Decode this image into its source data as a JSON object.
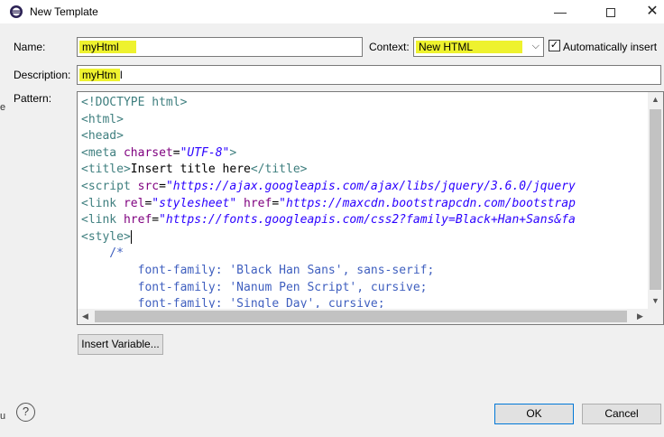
{
  "window": {
    "title": "New Template"
  },
  "form": {
    "name_label": "Name:",
    "name_value": "myHtml",
    "context_label": "Context:",
    "context_value": "New HTML",
    "auto_insert_label": "Automatically insert",
    "auto_insert_checked": true,
    "description_label": "Description:",
    "description_value_highlighted": "myHtm",
    "description_value_rest": "l",
    "pattern_label": "Pattern:",
    "highlight_color": "#eef22e"
  },
  "pattern": {
    "lines": [
      {
        "parts": [
          {
            "t": "tag",
            "s": "<!DOCTYPE html>"
          }
        ]
      },
      {
        "parts": [
          {
            "t": "tag",
            "s": "<html>"
          }
        ]
      },
      {
        "parts": [
          {
            "t": "tag",
            "s": "<head>"
          }
        ]
      },
      {
        "parts": [
          {
            "t": "tag",
            "s": "<meta "
          },
          {
            "t": "attr",
            "s": "charset"
          },
          {
            "t": "plain",
            "s": "="
          },
          {
            "t": "val",
            "s": "\"UTF-8\""
          },
          {
            "t": "tag",
            "s": ">"
          }
        ]
      },
      {
        "parts": [
          {
            "t": "tag",
            "s": "<title>"
          },
          {
            "t": "plain",
            "s": "Insert title here"
          },
          {
            "t": "tag",
            "s": "</title>"
          }
        ]
      },
      {
        "parts": [
          {
            "t": "tag",
            "s": "<script "
          },
          {
            "t": "attr",
            "s": "src"
          },
          {
            "t": "plain",
            "s": "="
          },
          {
            "t": "val",
            "s": "\"https://ajax.googleapis.com/ajax/libs/jquery/3.6.0/jquery"
          }
        ]
      },
      {
        "parts": [
          {
            "t": "tag",
            "s": "<link "
          },
          {
            "t": "attr",
            "s": "rel"
          },
          {
            "t": "plain",
            "s": "="
          },
          {
            "t": "val",
            "s": "\"stylesheet\""
          },
          {
            "t": "plain",
            "s": " "
          },
          {
            "t": "attr",
            "s": "href"
          },
          {
            "t": "plain",
            "s": "="
          },
          {
            "t": "val",
            "s": "\"https://maxcdn.bootstrapcdn.com/bootstrap"
          }
        ]
      },
      {
        "parts": [
          {
            "t": "tag",
            "s": "<link "
          },
          {
            "t": "attr",
            "s": "href"
          },
          {
            "t": "plain",
            "s": "="
          },
          {
            "t": "val",
            "s": "\"https://fonts.googleapis.com/css2?family=Black+Han+Sans&fa"
          }
        ]
      },
      {
        "parts": [
          {
            "t": "tag",
            "s": "<style>"
          }
        ],
        "caret": true
      },
      {
        "parts": [
          {
            "t": "cm",
            "s": "    /*"
          }
        ]
      },
      {
        "parts": [
          {
            "t": "cm",
            "s": "        font-family: 'Black Han Sans', sans-serif;"
          }
        ]
      },
      {
        "parts": [
          {
            "t": "cm",
            "s": "        font-family: 'Nanum Pen Script', cursive;"
          }
        ]
      },
      {
        "parts": [
          {
            "t": "cm",
            "s": "        font-family: 'Single Day', cursive;"
          }
        ]
      }
    ]
  },
  "buttons": {
    "insert_variable": "Insert Variable...",
    "ok": "OK",
    "cancel": "Cancel"
  },
  "edge_marks": [
    "e",
    "u"
  ]
}
